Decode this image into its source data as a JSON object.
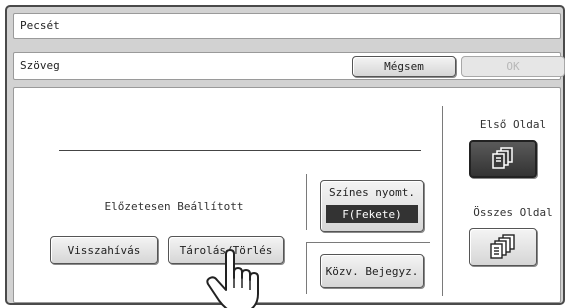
{
  "header": {
    "title": "Pecsét"
  },
  "toolbar": {
    "title": "Szöveg",
    "cancel_label": "Mégsem",
    "ok_label": "OK"
  },
  "preset": {
    "label": "Előzetesen Beállított",
    "recall_label": "Visszahívás",
    "store_label": "Tárolás/Törlés"
  },
  "color": {
    "label": "Színes nyomt.",
    "value": "F(Fekete)"
  },
  "common_label": "Közv. Bejegyz.",
  "pages": {
    "first_label": "Első Oldal",
    "all_label": "Összes Oldal",
    "selected": "first"
  },
  "icons": {
    "first": "single-page-stack-icon",
    "all": "multi-page-stack-icon",
    "pointer": "pointing-hand-icon"
  },
  "colors": {
    "frame_background": "#d2d2d2",
    "selected_button": "#3a3a3a"
  }
}
